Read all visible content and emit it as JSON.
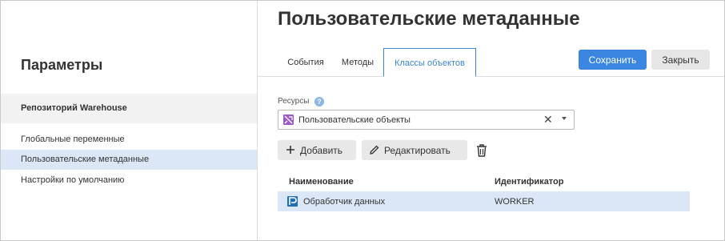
{
  "sidebar": {
    "title": "Параметры",
    "section": "Репозиторий Warehouse",
    "items": [
      {
        "label": "Глобальные переменные",
        "active": false
      },
      {
        "label": "Пользовательские метаданные",
        "active": true
      },
      {
        "label": "Настройки по умолчанию",
        "active": false
      }
    ]
  },
  "main": {
    "title": "Пользовательские метаданные",
    "tabs": [
      {
        "label": "События",
        "active": false
      },
      {
        "label": "Методы",
        "active": false
      },
      {
        "label": "Классы объектов",
        "active": true
      }
    ],
    "save_label": "Сохранить",
    "close_label": "Закрыть",
    "resources": {
      "label": "Ресурсы",
      "help": "?",
      "value": "Пользовательские объекты",
      "clear": "✕"
    },
    "toolbar": {
      "add_label": "Добавить",
      "edit_label": "Редактировать"
    },
    "table": {
      "columns": [
        "Наименование",
        "Идентификатор"
      ],
      "rows": [
        {
          "name": "Обработчик данных",
          "id": "WORKER"
        }
      ]
    }
  },
  "colors": {
    "accent": "#3b86e0",
    "selection": "#dbe7f6"
  }
}
